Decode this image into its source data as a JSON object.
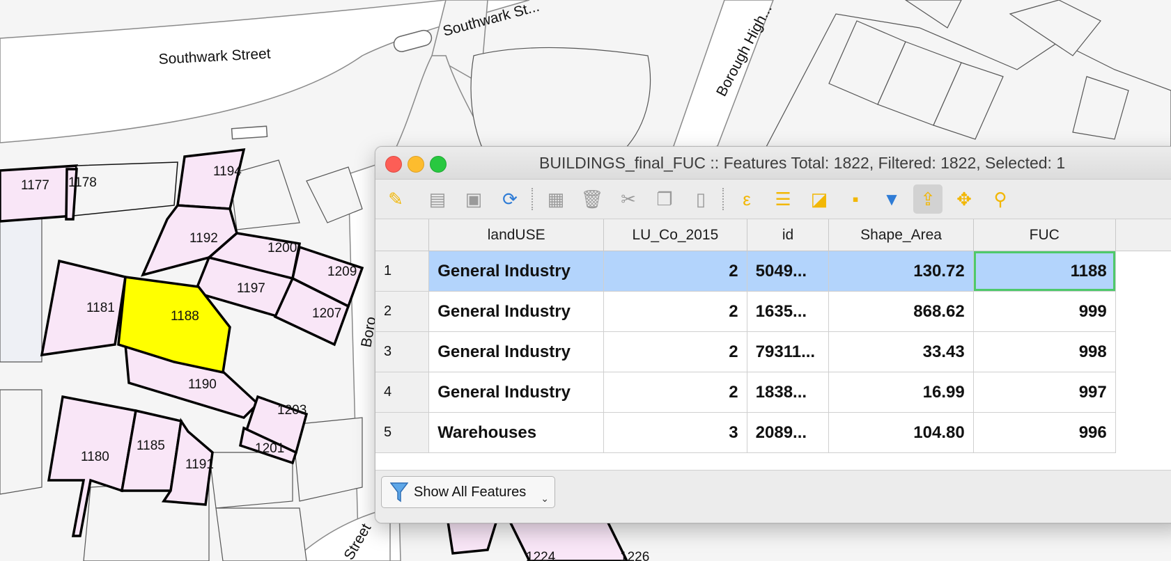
{
  "map": {
    "street_labels": [
      "Southwark Street",
      "Southwark St...",
      "Borough High...",
      "Boro...",
      "Street"
    ],
    "building_labels": [
      "1177",
      "1178",
      "1194",
      "1192",
      "1200",
      "1209",
      "1197",
      "1181",
      "1188",
      "1207",
      "1190",
      "1203",
      "1180",
      "1185",
      "1191",
      "1201",
      "1224",
      "1226"
    ],
    "selected_building": "1188",
    "colors": {
      "building_fill": "#f9e6f7",
      "selected_fill": "#ffff00",
      "road": "#ffffff",
      "background": "#f4f4f4"
    }
  },
  "window": {
    "title": "BUILDINGS_final_FUC :: Features Total: 1822, Filtered: 1822, Selected: 1"
  },
  "toolbar": {
    "icons": [
      "pencil-icon",
      "multi-edit-icon",
      "save-icon",
      "reload-icon",
      "add-feature-icon",
      "delete-icon",
      "cut-icon",
      "copy-icon",
      "paste-icon",
      "expression-select-icon",
      "select-all-icon",
      "invert-selection-icon",
      "deselect-icon",
      "filter-icon",
      "move-selection-top-icon",
      "pan-to-selection-icon",
      "zoom-to-selection-icon"
    ]
  },
  "table": {
    "columns": [
      "landUSE",
      "LU_Co_2015",
      "id",
      "Shape_Area",
      "FUC"
    ],
    "rows": [
      {
        "n": "1",
        "landUSE": "General Industry",
        "lu": "2",
        "id": "5049...",
        "area": "130.72",
        "fuc": "1188"
      },
      {
        "n": "2",
        "landUSE": "General Industry",
        "lu": "2",
        "id": "1635...",
        "area": "868.62",
        "fuc": "999"
      },
      {
        "n": "3",
        "landUSE": "General Industry",
        "lu": "2",
        "id": "79311...",
        "area": "33.43",
        "fuc": "998"
      },
      {
        "n": "4",
        "landUSE": "General Industry",
        "lu": "2",
        "id": "1838...",
        "area": "16.99",
        "fuc": "997"
      },
      {
        "n": "5",
        "landUSE": "Warehouses",
        "lu": "3",
        "id": "2089...",
        "area": "104.80",
        "fuc": "996"
      }
    ],
    "selected_row": "1"
  },
  "footer": {
    "filter_button_label": "Show All Features"
  }
}
